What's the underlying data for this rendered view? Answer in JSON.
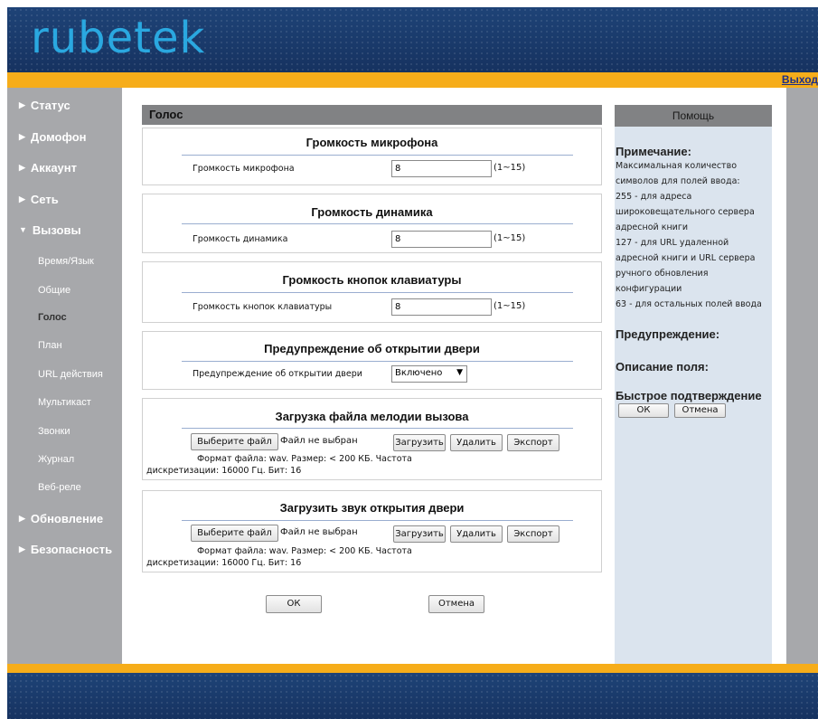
{
  "header": {
    "logo": "rubetek",
    "logout": "Выход"
  },
  "sidebar": {
    "main": [
      {
        "label": "Статус"
      },
      {
        "label": "Домофон"
      },
      {
        "label": "Аккаунт"
      },
      {
        "label": "Сеть"
      },
      {
        "label": "Вызовы"
      },
      {
        "label": "Обновление"
      },
      {
        "label": "Безопасность"
      }
    ],
    "sub": [
      {
        "label": "Время/Язык"
      },
      {
        "label": "Общие"
      },
      {
        "label": "Голос"
      },
      {
        "label": "План"
      },
      {
        "label": "URL действия"
      },
      {
        "label": "Мультикаст"
      },
      {
        "label": "Звонки"
      },
      {
        "label": "Журнал"
      },
      {
        "label": "Веб-реле"
      }
    ],
    "collapsed_icon": "triangle-right-icon",
    "expanded_icon": "triangle-down-icon"
  },
  "section": {
    "title": "Голос"
  },
  "panels": {
    "mic": {
      "title": "Громкость микрофона",
      "label": "Громкость микрофона",
      "value": "8",
      "range": "(1~15)"
    },
    "speaker": {
      "title": "Громкость динамика",
      "label": "Громкость динамика",
      "value": "8",
      "range": "(1~15)"
    },
    "keypad": {
      "title": "Громкость кнопок клавиатуры",
      "label": "Громкость кнопок клавиатуры",
      "value": "8",
      "range": "(1~15)"
    },
    "door_warning": {
      "title": "Предупреждение об открытии двери",
      "label": "Предупреждение об открытии двери",
      "selected": "Включено"
    },
    "ringtone": {
      "title": "Загрузка файла мелодии вызова",
      "choose_file": "Выберите файл",
      "file_status": "Файл не выбран",
      "upload": "Загрузить",
      "delete": "Удалить",
      "export": "Экспорт",
      "hint_line1": "Формат файла: wav. Размер: < 200 КБ. Частота",
      "hint_line2": "дискретизации: 16000 Гц. Бит: 16"
    },
    "door_sound": {
      "title": "Загрузить звук открытия двери",
      "choose_file": "Выберите файл",
      "file_status": "Файл не выбран",
      "upload": "Загрузить",
      "delete": "Удалить",
      "export": "Экспорт",
      "hint_line1": "Формат файла: wav. Размер: < 200 КБ. Частота",
      "hint_line2": "дискретизации: 16000 Гц. Бит: 16"
    }
  },
  "actions": {
    "ok": "ОК",
    "cancel": "Отмена"
  },
  "help": {
    "title": "Помощь",
    "note_heading": "Примечание:",
    "note_lines": [
      "Максимальная количество",
      "символов для полей ввода:",
      "255 - для адреса",
      "широковещательного сервера",
      "адресной книги",
      "127 - для URL удаленной",
      "адресной книги и URL сервера",
      "ручного обновления",
      "конфигурации",
      "63 - для остальных полей ввода"
    ],
    "warning_heading": "Предупреждение:",
    "field_desc_heading": "Описание поля:",
    "quick_confirm_heading": "Быстрое подтверждение",
    "ok": "ОК",
    "cancel": "Отмена"
  },
  "colors": {
    "header_bg": "#1b3c6d",
    "accent_orange": "#f6ad1a",
    "logo_blue": "#2aa8e0",
    "sidebar_bg": "#a7a8ab",
    "section_header_bg": "#818284",
    "help_bg": "#dbe4ee"
  }
}
